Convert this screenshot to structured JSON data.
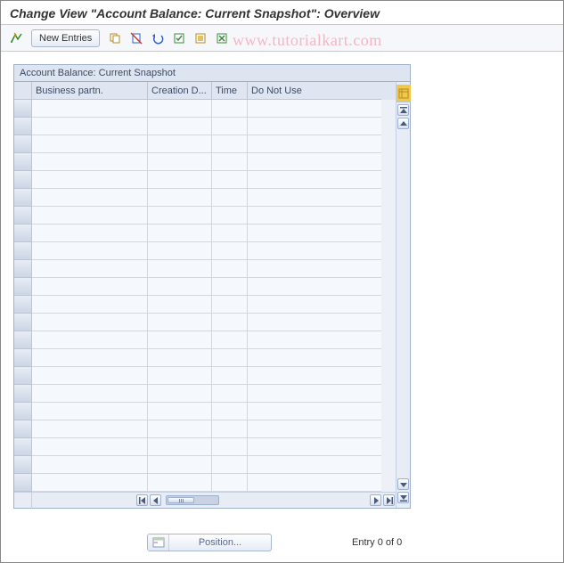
{
  "title": "Change View \"Account Balance: Current Snapshot\": Overview",
  "toolbar": {
    "new_entries": "New Entries"
  },
  "watermark": "www.tutorialkart.com",
  "panel": {
    "title": "Account Balance: Current Snapshot"
  },
  "grid": {
    "columns": [
      "Business partn.",
      "Creation D...",
      "Time",
      "Do Not Use"
    ],
    "row_count": 22
  },
  "footer": {
    "position_label": "Position...",
    "entry_status": "Entry 0 of 0"
  }
}
